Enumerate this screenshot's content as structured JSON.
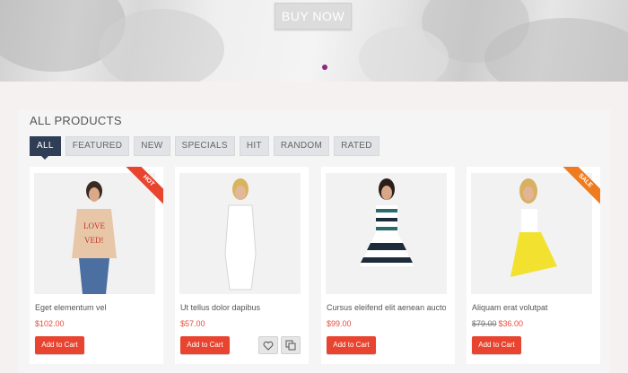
{
  "hero": {
    "cta_label": "BUY NOW"
  },
  "section": {
    "title": "ALL PRODUCTS"
  },
  "tabs": [
    "ALL",
    "FEATURED",
    "NEW",
    "SPECIALS",
    "HIT",
    "RANDOM",
    "RATED"
  ],
  "colors": {
    "accent_red": "#e8442f",
    "tab_active": "#2f3d55",
    "badge_hot": "#e8442f",
    "badge_sale": "#f07b1f",
    "price": "#e74c3c"
  },
  "products": [
    {
      "name": "Eget elementum vel",
      "price": "$102.00",
      "badge": "HOT",
      "cart_label": "Add to Cart"
    },
    {
      "name": "Ut tellus dolor dapibus",
      "price": "$57.00",
      "cart_label": "Add to Cart",
      "actions": [
        "heart-icon",
        "compare-icon"
      ]
    },
    {
      "name": "Cursus eleifend elit aenean aucto",
      "price": "$99.00",
      "cart_label": "Add to Cart"
    },
    {
      "name": "Aliquam erat volutpat",
      "old_price": "$79.00",
      "price": "$36.00",
      "badge": "SALE",
      "cart_label": "Add to Cart"
    }
  ]
}
